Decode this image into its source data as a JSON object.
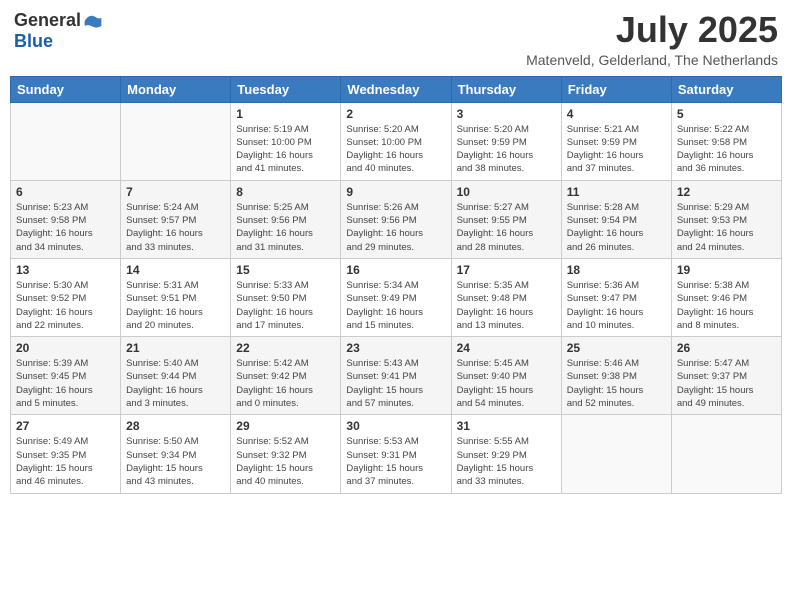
{
  "header": {
    "logo_general": "General",
    "logo_blue": "Blue",
    "month": "July 2025",
    "location": "Matenveld, Gelderland, The Netherlands"
  },
  "weekdays": [
    "Sunday",
    "Monday",
    "Tuesday",
    "Wednesday",
    "Thursday",
    "Friday",
    "Saturday"
  ],
  "weeks": [
    [
      {
        "day": "",
        "info": ""
      },
      {
        "day": "",
        "info": ""
      },
      {
        "day": "1",
        "info": "Sunrise: 5:19 AM\nSunset: 10:00 PM\nDaylight: 16 hours\nand 41 minutes."
      },
      {
        "day": "2",
        "info": "Sunrise: 5:20 AM\nSunset: 10:00 PM\nDaylight: 16 hours\nand 40 minutes."
      },
      {
        "day": "3",
        "info": "Sunrise: 5:20 AM\nSunset: 9:59 PM\nDaylight: 16 hours\nand 38 minutes."
      },
      {
        "day": "4",
        "info": "Sunrise: 5:21 AM\nSunset: 9:59 PM\nDaylight: 16 hours\nand 37 minutes."
      },
      {
        "day": "5",
        "info": "Sunrise: 5:22 AM\nSunset: 9:58 PM\nDaylight: 16 hours\nand 36 minutes."
      }
    ],
    [
      {
        "day": "6",
        "info": "Sunrise: 5:23 AM\nSunset: 9:58 PM\nDaylight: 16 hours\nand 34 minutes."
      },
      {
        "day": "7",
        "info": "Sunrise: 5:24 AM\nSunset: 9:57 PM\nDaylight: 16 hours\nand 33 minutes."
      },
      {
        "day": "8",
        "info": "Sunrise: 5:25 AM\nSunset: 9:56 PM\nDaylight: 16 hours\nand 31 minutes."
      },
      {
        "day": "9",
        "info": "Sunrise: 5:26 AM\nSunset: 9:56 PM\nDaylight: 16 hours\nand 29 minutes."
      },
      {
        "day": "10",
        "info": "Sunrise: 5:27 AM\nSunset: 9:55 PM\nDaylight: 16 hours\nand 28 minutes."
      },
      {
        "day": "11",
        "info": "Sunrise: 5:28 AM\nSunset: 9:54 PM\nDaylight: 16 hours\nand 26 minutes."
      },
      {
        "day": "12",
        "info": "Sunrise: 5:29 AM\nSunset: 9:53 PM\nDaylight: 16 hours\nand 24 minutes."
      }
    ],
    [
      {
        "day": "13",
        "info": "Sunrise: 5:30 AM\nSunset: 9:52 PM\nDaylight: 16 hours\nand 22 minutes."
      },
      {
        "day": "14",
        "info": "Sunrise: 5:31 AM\nSunset: 9:51 PM\nDaylight: 16 hours\nand 20 minutes."
      },
      {
        "day": "15",
        "info": "Sunrise: 5:33 AM\nSunset: 9:50 PM\nDaylight: 16 hours\nand 17 minutes."
      },
      {
        "day": "16",
        "info": "Sunrise: 5:34 AM\nSunset: 9:49 PM\nDaylight: 16 hours\nand 15 minutes."
      },
      {
        "day": "17",
        "info": "Sunrise: 5:35 AM\nSunset: 9:48 PM\nDaylight: 16 hours\nand 13 minutes."
      },
      {
        "day": "18",
        "info": "Sunrise: 5:36 AM\nSunset: 9:47 PM\nDaylight: 16 hours\nand 10 minutes."
      },
      {
        "day": "19",
        "info": "Sunrise: 5:38 AM\nSunset: 9:46 PM\nDaylight: 16 hours\nand 8 minutes."
      }
    ],
    [
      {
        "day": "20",
        "info": "Sunrise: 5:39 AM\nSunset: 9:45 PM\nDaylight: 16 hours\nand 5 minutes."
      },
      {
        "day": "21",
        "info": "Sunrise: 5:40 AM\nSunset: 9:44 PM\nDaylight: 16 hours\nand 3 minutes."
      },
      {
        "day": "22",
        "info": "Sunrise: 5:42 AM\nSunset: 9:42 PM\nDaylight: 16 hours\nand 0 minutes."
      },
      {
        "day": "23",
        "info": "Sunrise: 5:43 AM\nSunset: 9:41 PM\nDaylight: 15 hours\nand 57 minutes."
      },
      {
        "day": "24",
        "info": "Sunrise: 5:45 AM\nSunset: 9:40 PM\nDaylight: 15 hours\nand 54 minutes."
      },
      {
        "day": "25",
        "info": "Sunrise: 5:46 AM\nSunset: 9:38 PM\nDaylight: 15 hours\nand 52 minutes."
      },
      {
        "day": "26",
        "info": "Sunrise: 5:47 AM\nSunset: 9:37 PM\nDaylight: 15 hours\nand 49 minutes."
      }
    ],
    [
      {
        "day": "27",
        "info": "Sunrise: 5:49 AM\nSunset: 9:35 PM\nDaylight: 15 hours\nand 46 minutes."
      },
      {
        "day": "28",
        "info": "Sunrise: 5:50 AM\nSunset: 9:34 PM\nDaylight: 15 hours\nand 43 minutes."
      },
      {
        "day": "29",
        "info": "Sunrise: 5:52 AM\nSunset: 9:32 PM\nDaylight: 15 hours\nand 40 minutes."
      },
      {
        "day": "30",
        "info": "Sunrise: 5:53 AM\nSunset: 9:31 PM\nDaylight: 15 hours\nand 37 minutes."
      },
      {
        "day": "31",
        "info": "Sunrise: 5:55 AM\nSunset: 9:29 PM\nDaylight: 15 hours\nand 33 minutes."
      },
      {
        "day": "",
        "info": ""
      },
      {
        "day": "",
        "info": ""
      }
    ]
  ]
}
